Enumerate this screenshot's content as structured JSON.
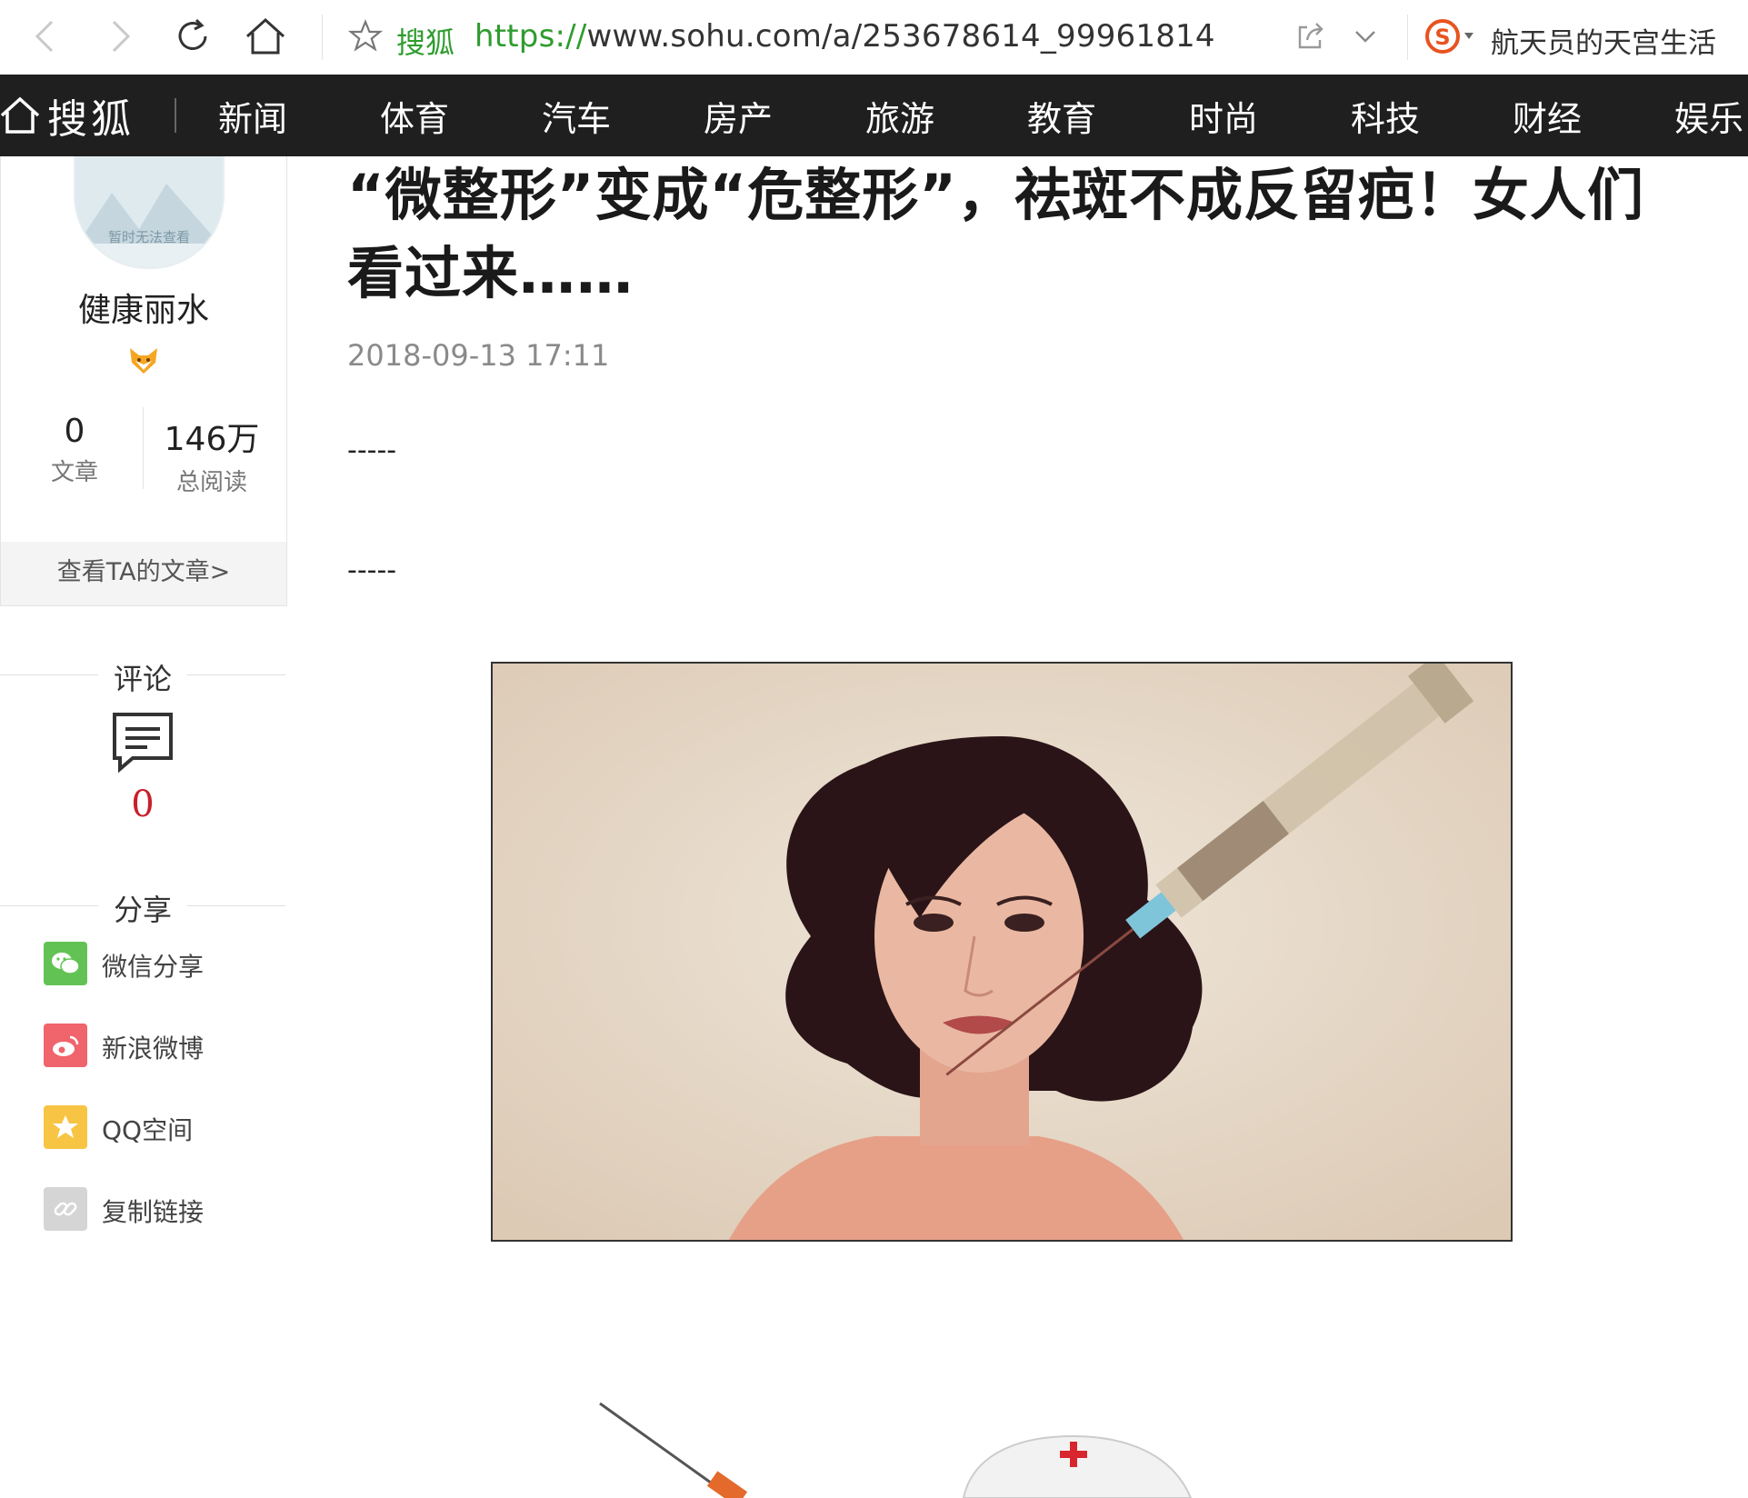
{
  "browser": {
    "site_name": "搜狐",
    "url_protocol": "https://",
    "url_rest": "www.sohu.com/a/253678614_99961814",
    "search_label": "航天员的天宫生活"
  },
  "nav": {
    "logo": "搜狐",
    "items": [
      "新闻",
      "体育",
      "汽车",
      "房产",
      "旅游",
      "教育",
      "时尚",
      "科技",
      "财经",
      "娱乐"
    ]
  },
  "author": {
    "avatar_placeholder": "暂时无法查看",
    "name": "健康丽水",
    "articles_count": "0",
    "articles_label": "文章",
    "reads_count": "146万",
    "reads_label": "总阅读",
    "view_articles": "查看TA的文章>"
  },
  "comments": {
    "title": "评论",
    "count": "0"
  },
  "share": {
    "title": "分享",
    "items": [
      {
        "label": "微信分享",
        "icon": "wechat-icon",
        "color": "#62c354"
      },
      {
        "label": "新浪微博",
        "icon": "weibo-icon",
        "color": "#f0646b"
      },
      {
        "label": "QQ空间",
        "icon": "qzone-icon",
        "color": "#f7c543"
      },
      {
        "label": "复制链接",
        "icon": "link-icon",
        "color": "#d5d5d5"
      }
    ]
  },
  "article": {
    "title": "“微整形”变成“危整形”，祛斑不成反留疤！女人们看过来……",
    "date": "2018-09-13 17:11",
    "separator1": "-----",
    "separator2": "-----"
  },
  "colors": {
    "navbar_bg": "#1f1f1f",
    "accent_red": "#c8202c",
    "url_green": "#2e9c2e"
  }
}
